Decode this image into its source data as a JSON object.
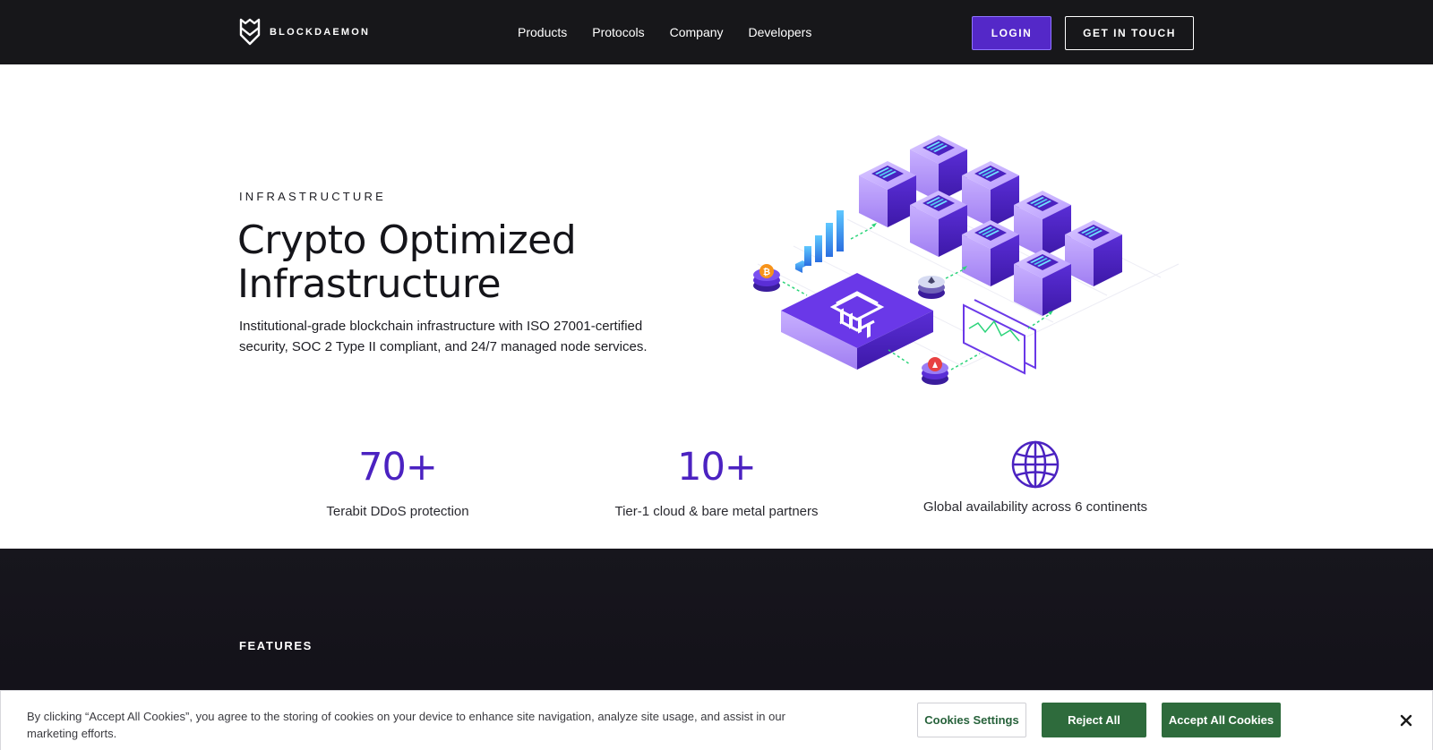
{
  "brand": {
    "name": "BLOCKDAEMON",
    "logo_icon": "blockdaemon-shield-icon"
  },
  "nav": {
    "items": [
      {
        "label": "Products"
      },
      {
        "label": "Protocols"
      },
      {
        "label": "Company"
      },
      {
        "label": "Developers"
      }
    ]
  },
  "header": {
    "login_label": "LOGIN",
    "contact_label": "GET IN TOUCH"
  },
  "hero": {
    "eyebrow": "INFRASTRUCTURE",
    "title": "Crypto Optimized Infrastructure",
    "description": "Institutional-grade blockchain infrastructure with ISO 27001-certified security, SOC 2 Type II compliant, and 24/7 managed node services.",
    "illustration_icon": "isometric-infrastructure-illustration"
  },
  "stats": [
    {
      "value": "70+",
      "label": "Terabit DDoS protection"
    },
    {
      "value": "10+",
      "label": "Tier-1 cloud & bare metal partners"
    },
    {
      "icon": "globe-icon",
      "label": "Global availability across 6 continents"
    }
  ],
  "features": {
    "label": "FEATURES"
  },
  "cookie_banner": {
    "text": "By clicking “Accept All Cookies”, you agree to the storing of cookies on your device to enhance site navigation, analyze site usage, and assist in our marketing efforts.",
    "settings_label": "Cookies Settings",
    "reject_label": "Reject All",
    "accept_label": "Accept All Cookies",
    "close_icon": "close-icon"
  },
  "colors": {
    "header_bg": "#17171a",
    "accent_purple": "#5428c8",
    "stat_purple": "#4b22c1",
    "features_bg": "#17161d",
    "cookie_green": "#2e6b3c"
  }
}
